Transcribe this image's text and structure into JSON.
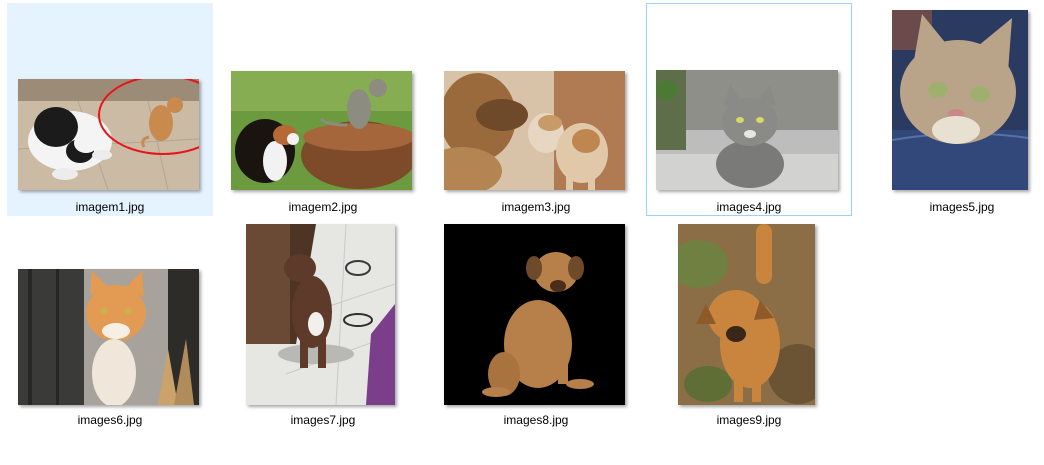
{
  "explorer": {
    "files": [
      {
        "name": "imagem1.jpg",
        "thumb_icon": "dog-and-cat-photo-icon"
      },
      {
        "name": "imagem2.jpg",
        "thumb_icon": "dog-and-cat-photo-icon"
      },
      {
        "name": "imagem3.jpg",
        "thumb_icon": "dog-and-cat-photo-icon"
      },
      {
        "name": "images4.jpg",
        "thumb_icon": "cat-photo-icon"
      },
      {
        "name": "images5.jpg",
        "thumb_icon": "cat-photo-icon"
      },
      {
        "name": "images6.jpg",
        "thumb_icon": "cat-photo-icon"
      },
      {
        "name": "images7.jpg",
        "thumb_icon": "dog-photo-icon"
      },
      {
        "name": "images8.jpg",
        "thumb_icon": "dog-photo-icon"
      },
      {
        "name": "images9.jpg",
        "thumb_icon": "dog-photo-icon"
      }
    ],
    "selected_file": "imagem1.jpg",
    "focused_file": "images4.jpg",
    "colors": {
      "selection_bg": "#e5f3ff",
      "focus_border": "#99d1ff",
      "annotation_circle": "#e8141b"
    }
  }
}
